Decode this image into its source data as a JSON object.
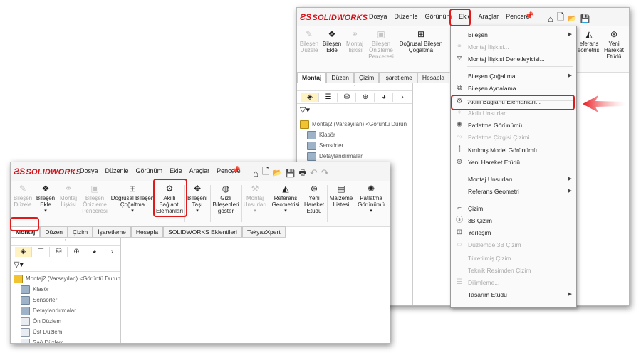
{
  "back": {
    "menu": [
      "Dosya",
      "Düzenle",
      "Görünüm",
      "Ekle",
      "Araçlar",
      "Pencere"
    ],
    "ribbon": [
      {
        "label": "Bileşen\nDüzele",
        "icon": "edit-component-icon",
        "disabled": true
      },
      {
        "label": "Bileşen\nEkle",
        "icon": "insert-component-icon",
        "disabled": false
      },
      {
        "label": "Montaj\nİlişkisi",
        "icon": "mate-icon",
        "disabled": true
      },
      {
        "label": "Bileşen\nÖnizleme\nPenceresi",
        "icon": "preview-window-icon",
        "disabled": true
      },
      {
        "label": "Doğrusal Bileşen\nÇoğaltma",
        "icon": "linear-pattern-icon",
        "disabled": false
      }
    ],
    "ribbon_right": [
      {
        "label": "eferans\neometrisi",
        "icon": "reference-geometry-icon"
      },
      {
        "label": "Yeni\nHareket\nEtüdü",
        "icon": "motion-study-icon"
      }
    ],
    "tabs": [
      "Montaj",
      "Düzen",
      "Çizim",
      "İşaretleme",
      "Hesapla"
    ],
    "tree": [
      {
        "label": "Montaj2 (Varsayılan) <Görüntü Durun",
        "kind": "root"
      },
      {
        "label": "Klasör",
        "kind": "folder"
      },
      {
        "label": "Sensörler",
        "kind": "folder"
      },
      {
        "label": "Detaylandırmalar",
        "kind": "folder"
      }
    ],
    "dropdown": [
      {
        "label": "Bileşen",
        "icon": "",
        "disabled": false,
        "sub": true
      },
      {
        "label": "Montaj İlişkisi...",
        "icon": "mate-icon",
        "disabled": true,
        "sub": false
      },
      {
        "label": "Montaj İlişkisi Denetleyicisi...",
        "icon": "mate-controller-icon",
        "disabled": false,
        "sub": false
      },
      {
        "label": "Bileşen Çoğaltma...",
        "icon": "",
        "disabled": false,
        "sub": true
      },
      {
        "label": "Bileşen Aynalama...",
        "icon": "mirror-component-icon",
        "disabled": false,
        "sub": false
      },
      {
        "label": "Akıllı Bağlantı Elemanları...",
        "icon": "smart-fastener-icon",
        "disabled": false,
        "sub": false
      },
      {
        "label": "Akıllı Unsurlar...",
        "icon": "smart-feature-icon",
        "disabled": true,
        "sub": false
      },
      {
        "label": "Patlatma Görünümü...",
        "icon": "exploded-view-icon",
        "disabled": false,
        "sub": false
      },
      {
        "label": "Patlatma Çizgisi Çizimi",
        "icon": "explode-line-icon",
        "disabled": true,
        "sub": false
      },
      {
        "label": "Kırılmış Model Görünümü...",
        "icon": "broken-view-icon",
        "disabled": false,
        "sub": false
      },
      {
        "label": "Yeni Hareket Etüdü",
        "icon": "motion-study-icon",
        "disabled": false,
        "sub": false
      },
      {
        "label": "Montaj Unsurları",
        "icon": "",
        "disabled": false,
        "sub": true
      },
      {
        "label": "Referans Geometri",
        "icon": "",
        "disabled": false,
        "sub": true
      },
      {
        "label": "Çizim",
        "icon": "sketch-icon",
        "disabled": false,
        "sub": false
      },
      {
        "label": "3B Çizim",
        "icon": "3d-sketch-icon",
        "disabled": false,
        "sub": false
      },
      {
        "label": "Yerleşim",
        "icon": "layout-icon",
        "disabled": false,
        "sub": false
      },
      {
        "label": "Düzlemde 3B Çizim",
        "icon": "3d-sketch-plane-icon",
        "disabled": true,
        "sub": false
      },
      {
        "label": "Türetilmiş Çizim",
        "icon": "",
        "disabled": true,
        "sub": false
      },
      {
        "label": "Teknik Resimden Çizim",
        "icon": "",
        "disabled": true,
        "sub": false
      },
      {
        "label": "Dilimleme...",
        "icon": "slicing-icon",
        "disabled": true,
        "sub": false
      },
      {
        "label": "Tasarım Etüdü",
        "icon": "",
        "disabled": false,
        "sub": true
      }
    ]
  },
  "front": {
    "menu": [
      "Dosya",
      "Düzenle",
      "Görünüm",
      "Ekle",
      "Araçlar",
      "Pencere"
    ],
    "ribbon": [
      {
        "label": "Bileşen\nDüzele",
        "icon": "edit-component-icon",
        "disabled": true,
        "arrow": false
      },
      {
        "label": "Bileşen\nEkle",
        "icon": "insert-component-icon",
        "disabled": false,
        "arrow": true
      },
      {
        "label": "Montaj\nİlişkisi",
        "icon": "mate-icon",
        "disabled": true,
        "arrow": false
      },
      {
        "label": "Bileşen\nÖnizleme\nPenceresi",
        "icon": "preview-window-icon",
        "disabled": true,
        "arrow": false
      },
      {
        "label": "Doğrusal Bileşen\nÇoğaltma",
        "icon": "linear-pattern-icon",
        "disabled": false,
        "arrow": true
      },
      {
        "label": "Akıllı\nBağlantı\nElemanları",
        "icon": "smart-fastener-icon",
        "disabled": false,
        "arrow": false
      },
      {
        "label": "Bileşeni\nTaşı",
        "icon": "move-component-icon",
        "disabled": false,
        "arrow": true
      },
      {
        "label": "Gizli\nBileşenleri\ngöster",
        "icon": "show-hidden-icon",
        "disabled": false,
        "arrow": false
      },
      {
        "label": "Montaj\nUnsurları",
        "icon": "assembly-features-icon",
        "disabled": true,
        "arrow": true
      },
      {
        "label": "Referans\nGeometrisi",
        "icon": "reference-geometry-icon",
        "disabled": false,
        "arrow": true
      },
      {
        "label": "Yeni\nHareket\nEtüdü",
        "icon": "motion-study-icon",
        "disabled": false,
        "arrow": false
      },
      {
        "label": "Malzeme\nListesi",
        "icon": "bom-icon",
        "disabled": false,
        "arrow": false
      },
      {
        "label": "Patlatma\nGörünümü",
        "icon": "exploded-view-icon",
        "disabled": false,
        "arrow": true
      }
    ],
    "tabs": [
      "Montaj",
      "Düzen",
      "Çizim",
      "İşaretleme",
      "Hesapla",
      "SOLIDWORKS Eklentileri",
      "TekyazXpert"
    ],
    "tree": [
      {
        "label": "Montaj2 (Varsayılan) <Görüntü Durun",
        "kind": "root"
      },
      {
        "label": "Klasör",
        "kind": "folder"
      },
      {
        "label": "Sensörler",
        "kind": "folder"
      },
      {
        "label": "Detaylandırmalar",
        "kind": "folder"
      },
      {
        "label": "Ön Düzlem",
        "kind": "plane"
      },
      {
        "label": "Üst Düzlem",
        "kind": "plane"
      },
      {
        "label": "Sağ Düzlem",
        "kind": "plane"
      }
    ]
  },
  "brand": "SOLIDWORKS",
  "colors": {
    "accent": "#d3111a",
    "highlight": "#e01a1a"
  }
}
